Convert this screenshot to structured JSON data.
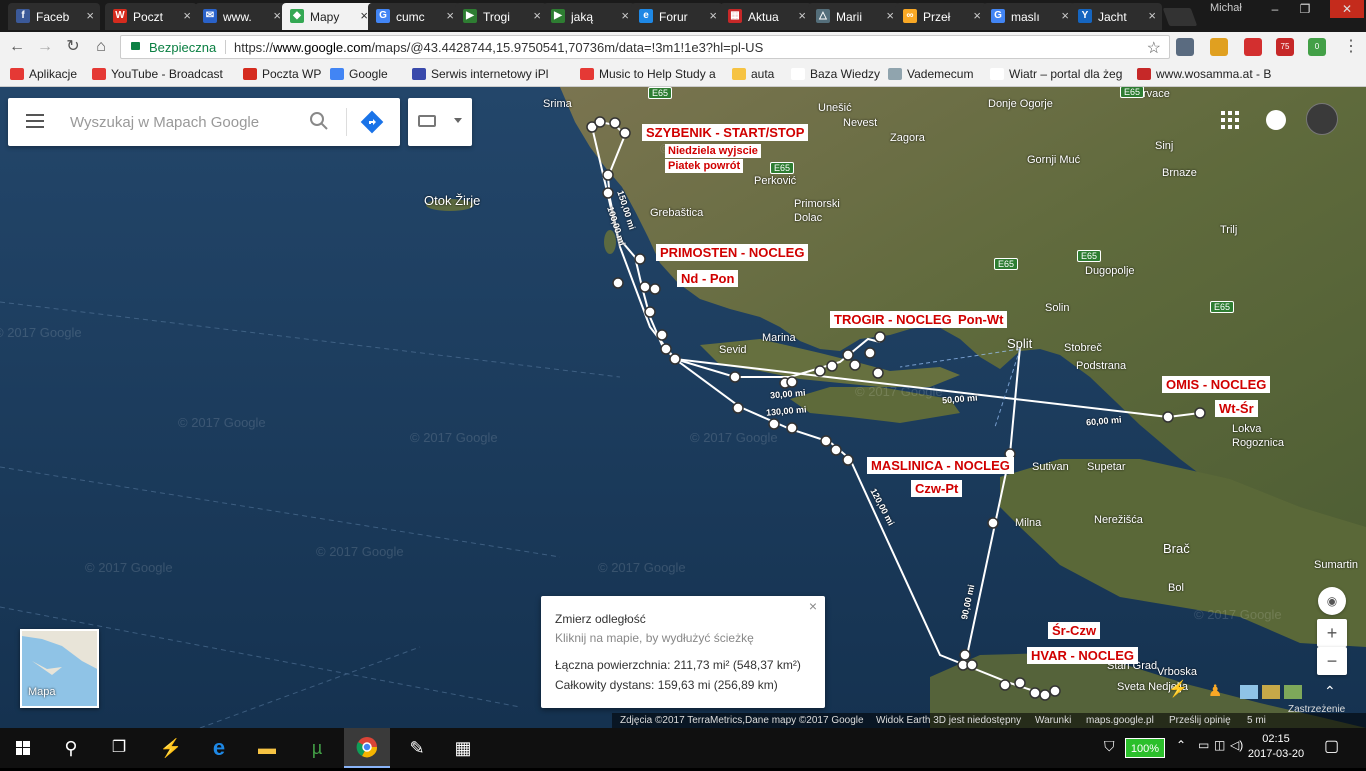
{
  "browser": {
    "tabs": [
      {
        "label": "Faceb",
        "fav": "f",
        "color": "#3b5998"
      },
      {
        "label": "Poczt",
        "fav": "W",
        "color": "#d52b1e"
      },
      {
        "label": "www.",
        "fav": "✉",
        "color": "#2a62c9"
      },
      {
        "label": "Mapy",
        "fav": "◆",
        "color": "#34a853"
      },
      {
        "label": "cumc",
        "fav": "G",
        "color": "#4285f4"
      },
      {
        "label": "Trogi",
        "fav": "▶",
        "color": "#2e7d32"
      },
      {
        "label": "jaką",
        "fav": "▶",
        "color": "#2e7d32"
      },
      {
        "label": "Forur",
        "fav": "e",
        "color": "#1e88e5"
      },
      {
        "label": "Aktua",
        "fav": "▦",
        "color": "#c62828"
      },
      {
        "label": "Marii",
        "fav": "△",
        "color": "#546e7a"
      },
      {
        "label": "Przeł",
        "fav": "∞",
        "color": "#f9a825"
      },
      {
        "label": "maslı",
        "fav": "G",
        "color": "#4285f4"
      },
      {
        "label": "Jacht",
        "fav": "Y",
        "color": "#1565c0"
      }
    ],
    "active_tab": 3,
    "window_user": "Michał",
    "secure_label": "Bezpieczna",
    "url_prefix": "https://",
    "url_domain": "www.google.com",
    "url_path": "/maps/@43.4428744,15.9750541,70736m/data=!3m1!1e3?hl=pl-US",
    "extensions": [
      {
        "name": "ext-1",
        "color": "#5a6b80",
        "badge": ""
      },
      {
        "name": "ext-2",
        "color": "#e0a020",
        "badge": ""
      },
      {
        "name": "ext-3",
        "color": "#d32f2f",
        "badge": ""
      },
      {
        "name": "ext-4",
        "color": "#c62828",
        "badge": "75"
      },
      {
        "name": "ext-5",
        "color": "#43a047",
        "badge": "0"
      }
    ],
    "bookmarks": [
      {
        "label": "Aplikacje",
        "color": "#e53935"
      },
      {
        "label": "YouTube - Broadcast",
        "color": "#e53935"
      },
      {
        "label": "Poczta WP",
        "color": "#d52b1e"
      },
      {
        "label": "Google",
        "color": "#4285f4"
      },
      {
        "label": "Serwis internetowy iPl",
        "color": "#3949ab"
      },
      {
        "label": "Music to Help Study a",
        "color": "#e53935"
      },
      {
        "label": "auta",
        "color": "#f6c343"
      },
      {
        "label": "Baza Wiedzy",
        "color": "#ffffff"
      },
      {
        "label": "Vademecum",
        "color": "#90a4ae"
      },
      {
        "label": "Wiatr – portal dla żeg",
        "color": "#ffffff"
      },
      {
        "label": "www.wosamma.at - B",
        "color": "#c62828"
      }
    ]
  },
  "maps": {
    "search_placeholder": "Wyszukaj w Mapach Google",
    "places": [
      {
        "name": "Srima",
        "cls": ""
      },
      {
        "name": "Unešić",
        "cls": ""
      },
      {
        "name": "Nevest",
        "cls": ""
      },
      {
        "name": "Zagora",
        "cls": ""
      },
      {
        "name": "Donje Ogorje",
        "cls": ""
      },
      {
        "name": "Hrvace",
        "cls": ""
      },
      {
        "name": "Perković",
        "cls": ""
      },
      {
        "name": "Primorski Dolac",
        "cls": ""
      },
      {
        "name": "Grebaštica",
        "cls": ""
      },
      {
        "name": "Otok Žirje",
        "cls": "big"
      },
      {
        "name": "Gornji Muć",
        "cls": ""
      },
      {
        "name": "Sinj",
        "cls": ""
      },
      {
        "name": "Brnaze",
        "cls": ""
      },
      {
        "name": "Trilj",
        "cls": ""
      },
      {
        "name": "Dugopolje",
        "cls": ""
      },
      {
        "name": "Solin",
        "cls": ""
      },
      {
        "name": "Split",
        "cls": "big"
      },
      {
        "name": "Stobreč",
        "cls": ""
      },
      {
        "name": "Podstrana",
        "cls": ""
      },
      {
        "name": "Marina",
        "cls": ""
      },
      {
        "name": "Sevid",
        "cls": ""
      },
      {
        "name": "Sutivan",
        "cls": ""
      },
      {
        "name": "Supetar",
        "cls": ""
      },
      {
        "name": "Milna",
        "cls": ""
      },
      {
        "name": "Nerežišća",
        "cls": ""
      },
      {
        "name": "Brač",
        "cls": "big"
      },
      {
        "name": "Sumartin",
        "cls": ""
      },
      {
        "name": "Bol",
        "cls": ""
      },
      {
        "name": "Lokva Rogoznica",
        "cls": ""
      },
      {
        "name": "Stari Grad",
        "cls": ""
      },
      {
        "name": "Vrboska",
        "cls": ""
      },
      {
        "name": "Sveta Nedjelja",
        "cls": ""
      }
    ],
    "roads": [
      "E65",
      "E65",
      "E65",
      "E65",
      "E65",
      "E65"
    ],
    "annotations": [
      {
        "text": "SZYBENIK - START/STOP",
        "cls": ""
      },
      {
        "text": "Niedziela wyjscie",
        "cls": "small"
      },
      {
        "text": "Piatek powrót",
        "cls": "small"
      },
      {
        "text": "PRIMOSTEN - NOCLEG",
        "cls": ""
      },
      {
        "text": "Nd - Pon",
        "cls": ""
      },
      {
        "text": "TROGIR - NOCLEG",
        "cls": ""
      },
      {
        "text": "Pon-Wt",
        "cls": ""
      },
      {
        "text": "OMIS - NOCLEG",
        "cls": ""
      },
      {
        "text": "Wt-Śr",
        "cls": ""
      },
      {
        "text": "MASLINICA - NOCLEG",
        "cls": ""
      },
      {
        "text": "Czw-Pt",
        "cls": ""
      },
      {
        "text": "Śr-Czw",
        "cls": ""
      },
      {
        "text": "HVAR - NOCLEG",
        "cls": ""
      }
    ],
    "distances": [
      "150,00 mi",
      "100,00 mi",
      "30,00 mi",
      "130,00 mi",
      "50,00 mi",
      "60,00 mi",
      "120,00 mi",
      "90,00 mi"
    ],
    "watermark": "© 2017 Google",
    "measure": {
      "title": "Zmierz odległość",
      "hint": "Kliknij na mapie, by wydłużyć ścieżkę",
      "area": "Łączna powierzchnia: 211,73 mi² (548,37 km²)",
      "distance": "Całkowity dystans: 159,63 mi (256,89 km)",
      "close": "×"
    },
    "minimap_label": "Mapa",
    "attribution": {
      "imagery": "Zdjęcia ©2017 TerraMetrics,Dane mapy ©2017 Google",
      "earth": "Widok Earth 3D jest niedostępny",
      "terms": "Warunki",
      "domain": "maps.google.pl",
      "feedback": "Prześlij opinię",
      "scale": "5 mi",
      "hide": "Zastrzeżenie"
    }
  },
  "taskbar": {
    "battery": "100%",
    "time": "02:15",
    "date": "2017-03-20"
  }
}
